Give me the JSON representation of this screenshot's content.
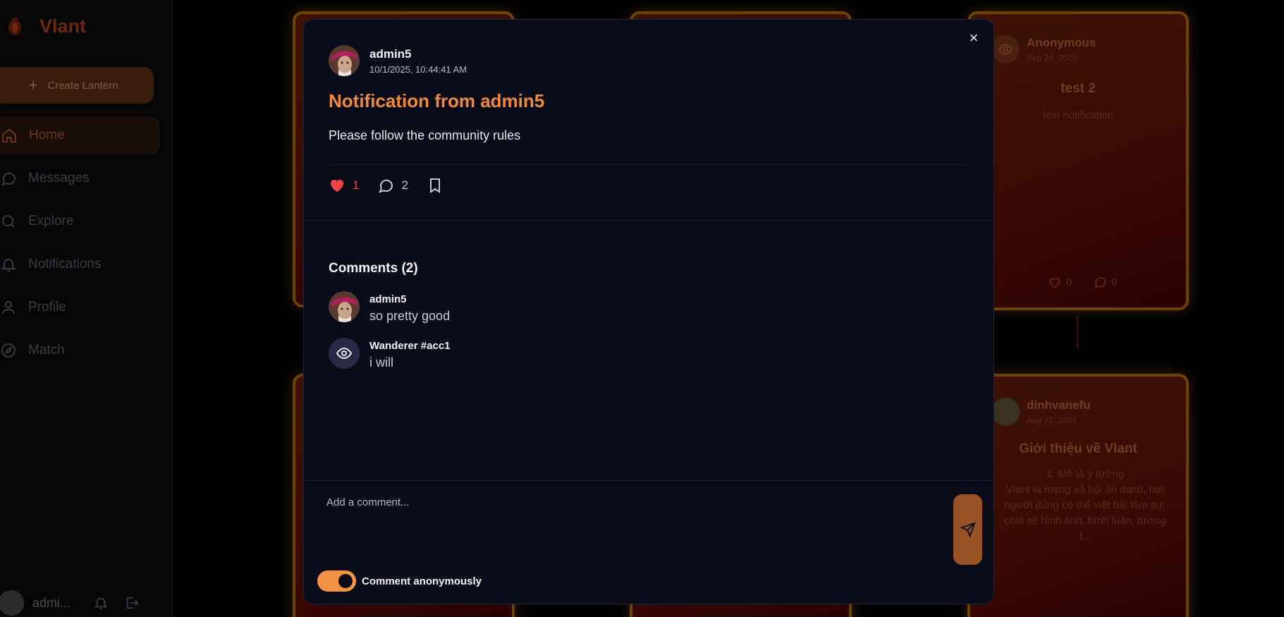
{
  "sidebar": {
    "brand": "Vlant",
    "create_label": "Create Lantern",
    "items": [
      {
        "label": "Home",
        "icon": "home-icon"
      },
      {
        "label": "Messages",
        "icon": "message-icon"
      },
      {
        "label": "Explore",
        "icon": "search-icon"
      },
      {
        "label": "Notifications",
        "icon": "bell-icon"
      },
      {
        "label": "Profile",
        "icon": "user-icon"
      },
      {
        "label": "Match",
        "icon": "compass-icon"
      }
    ],
    "footer": {
      "user": "admi..."
    }
  },
  "background_cards": [
    {
      "author": "Anonymous",
      "date": "Sep 24, 2025",
      "title": "test 2",
      "body": "test notification",
      "likes": "0",
      "comments": "0"
    },
    {
      "author": "dinhvanefu",
      "date": "Aug 27, 2025",
      "title": "Giới thiệu về Vlant",
      "body_lines": [
        "1. Mô tả ý tưởng",
        "Vlant là mạng xã hội ẩn danh, nơi",
        "người dùng có thể viết bài tâm sự,",
        "chia sẻ hình ảnh, bình luận, tương t..."
      ]
    }
  ],
  "modal": {
    "close": "×",
    "author": "admin5",
    "timestamp": "10/1/2025, 10:44:41 AM",
    "title": "Notification from admin5",
    "body": "Please follow the community rules",
    "likes": "1",
    "comments_count": "2",
    "comments_heading": "Comments (2)",
    "comments": [
      {
        "author": "admin5",
        "text": "so pretty good",
        "anonymous": false
      },
      {
        "author": "Wanderer #acc1",
        "text": "i will",
        "anonymous": true
      }
    ],
    "input_placeholder": "Add a comment...",
    "anon_label": "Comment anonymously",
    "anon_enabled": true
  },
  "colors": {
    "accent": "#f08a3a",
    "like": "#ef4444",
    "modal_bg": "#0b0c1a",
    "toggle": "#f39144"
  }
}
